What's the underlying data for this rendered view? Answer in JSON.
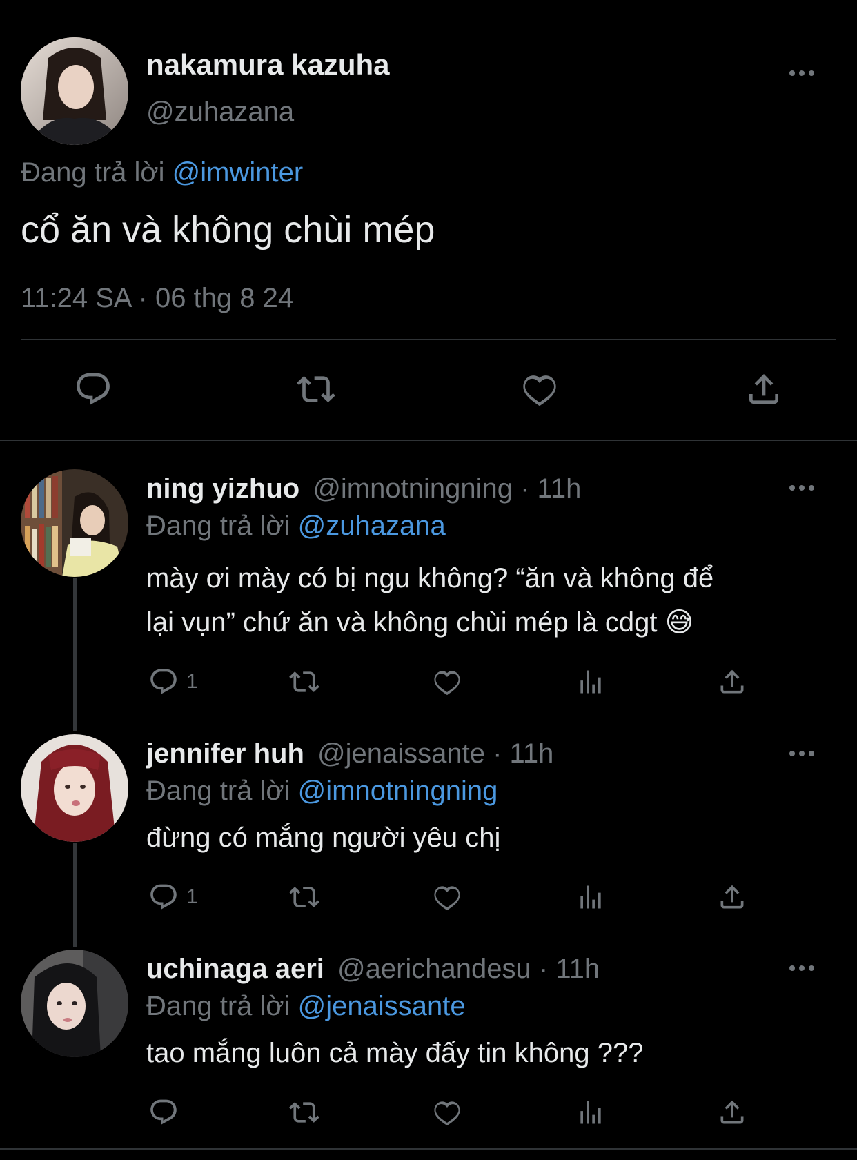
{
  "colors": {
    "background": "#000000",
    "text": "#e7e9ea",
    "muted": "#71767b",
    "link": "#4b98e0",
    "border": "#2f3336"
  },
  "main_tweet": {
    "display_name": "nakamura kazuha",
    "handle": "@zuhazana",
    "reply_prefix": "Đang trả lời",
    "reply_to": "@imwinter",
    "text": "cổ ăn và không chùi mép",
    "timestamp": "11:24 SA · 06 thg 8 24",
    "actions": {
      "reply_icon": "reply-icon",
      "retweet_icon": "retweet-icon",
      "like_icon": "heart-icon",
      "share_icon": "share-icon"
    }
  },
  "replies": [
    {
      "display_name": "ning yizhuo",
      "handle": "@imnotningning",
      "time": "· 11h",
      "reply_prefix": "Đang trả lời",
      "reply_to": "@zuhazana",
      "text_line1": "mày ơi mày có bị ngu không? “ăn và không để",
      "text_line2": "lại vụn” chứ ăn và không chùi mép là cdgt",
      "emoji": "😅",
      "reply_count": "1"
    },
    {
      "display_name": "jennifer huh",
      "handle": "@jenaissante",
      "time": "· 11h",
      "reply_prefix": "Đang trả lời",
      "reply_to": "@imnotningning",
      "text": "đừng có mắng người yêu chị",
      "reply_count": "1"
    },
    {
      "display_name": "uchinaga aeri",
      "handle": "@aerichandesu",
      "time": "· 11h",
      "reply_prefix": "Đang trả lời",
      "reply_to": "@jenaissante",
      "text": "tao mắng luôn cả mày đấy tin không ???",
      "reply_count": ""
    }
  ]
}
